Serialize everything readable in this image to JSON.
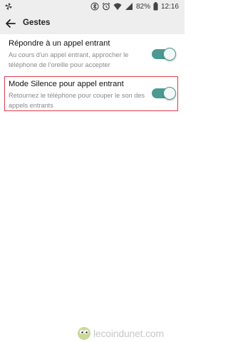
{
  "status": {
    "battery": "82%",
    "time": "12:16"
  },
  "header": {
    "title": "Gestes"
  },
  "settings": [
    {
      "title": "Répondre à un appel entrant",
      "subtitle": "Au cours d'un appel entrant, approcher le téléphone de l'oreille pour accepter",
      "enabled": true
    },
    {
      "title": "Mode Silence pour appel entrant",
      "subtitle": "Retournez le téléphone pour couper le son des appels entrants",
      "enabled": true
    }
  ],
  "watermark": {
    "text": "lecoindunet.com"
  },
  "colors": {
    "accent": "#4a9a92",
    "highlight": "#e03d4c"
  }
}
